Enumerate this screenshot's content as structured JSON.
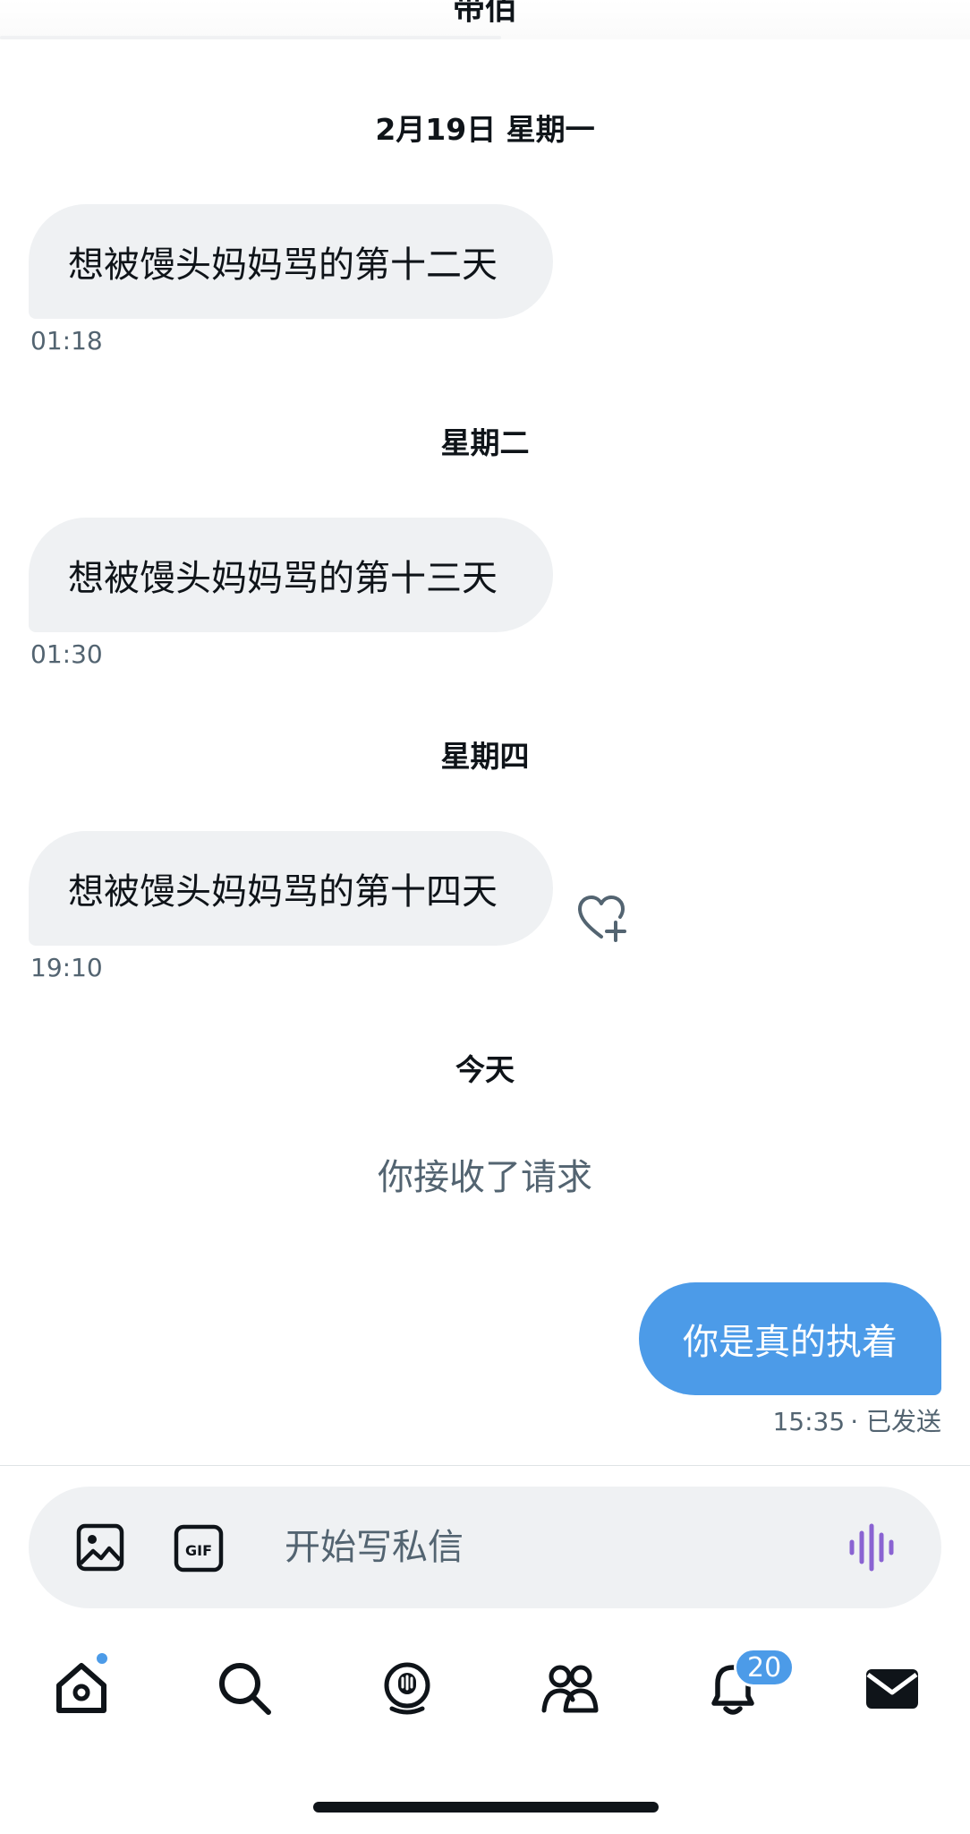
{
  "header": {
    "title_partial": "带佰"
  },
  "messages": [
    {
      "date": "2月19日 星期一",
      "text": "想被馒头妈妈骂的第十二天",
      "time": "01:18"
    },
    {
      "date": "星期二",
      "text": "想被馒头妈妈骂的第十三天",
      "time": "01:30"
    },
    {
      "date": "星期四",
      "text": "想被馒头妈妈骂的第十四天",
      "time": "19:10"
    }
  ],
  "today": {
    "date": "今天",
    "system_note": "你接收了请求",
    "outgoing": {
      "text": "你是真的执着",
      "time": "15:35",
      "status": "· 已发送"
    }
  },
  "composer": {
    "placeholder": "开始写私信",
    "value": ""
  },
  "tabbar": {
    "notifications_badge": "20"
  },
  "colors": {
    "accent": "#4c9be8",
    "bubble_in": "#eff1f3",
    "voice_icon": "#8a63d2"
  }
}
